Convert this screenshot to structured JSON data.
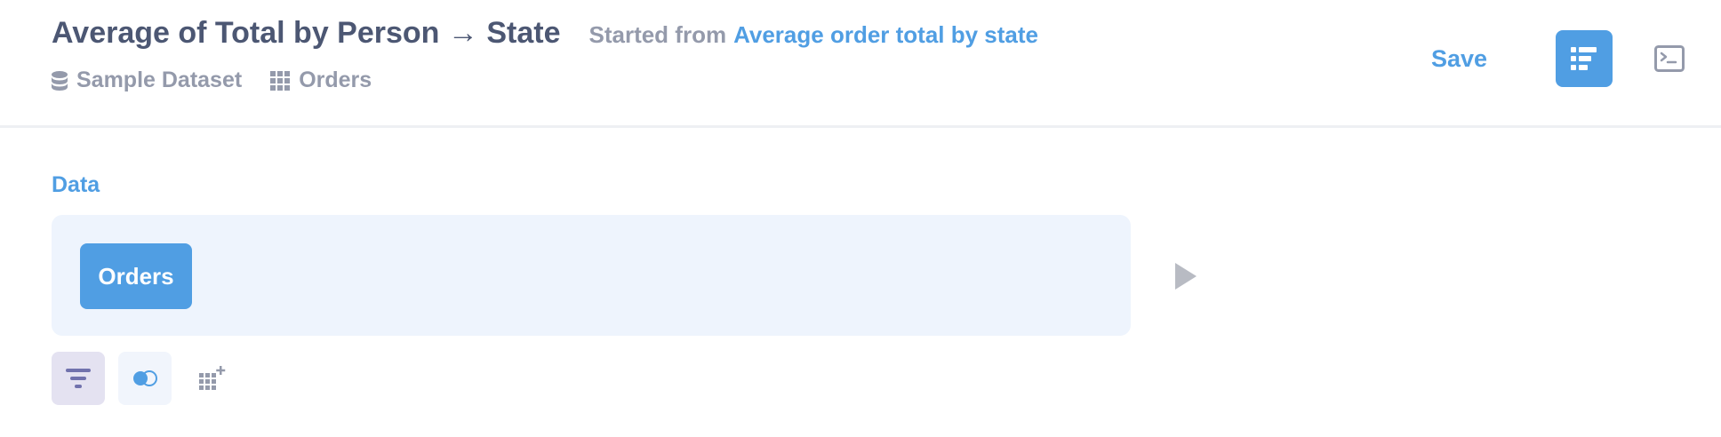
{
  "header": {
    "title": "Average of Total by Person → State",
    "subtitle_prefix": "Started from",
    "subtitle_link": "Average order total by state",
    "database": "Sample Dataset",
    "table": "Orders",
    "save_label": "Save"
  },
  "editor": {
    "section_label": "Data",
    "source_table": "Orders"
  },
  "icons": {
    "database": "database-icon",
    "table": "table-grid-icon",
    "notebook": "notebook-icon",
    "sql": "terminal-icon",
    "run": "play-icon",
    "filter": "filter-icon",
    "join": "join-icon",
    "custom_column": "add-column-icon"
  },
  "colors": {
    "brand": "#509ee3",
    "text_dark": "#4c5773",
    "text_light": "#949aab",
    "data_box_bg": "#eef4fd",
    "filter_accent": "#7172ad"
  }
}
